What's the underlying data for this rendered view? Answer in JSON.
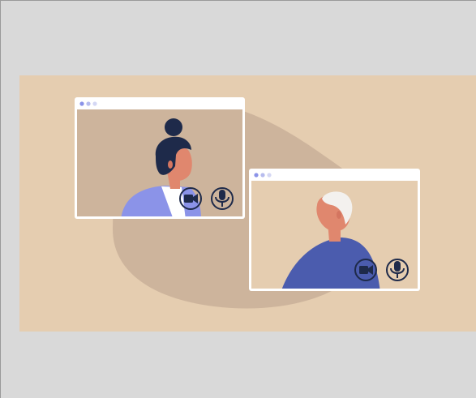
{
  "scene": {
    "description_kind": "video-call illustration",
    "colors": {
      "page_background": "#d9d9d9",
      "panel_background": "#e5cdb0",
      "blob": "#cdb49c",
      "window_frame": "#ffffff",
      "window_dots": "#8b93e8",
      "skin": "#e0876e",
      "hair_dark": "#1e2a4a",
      "hair_white": "#f3f1ee",
      "shirt_light": "#8b93e8",
      "shirt_dark": "#4b5cae",
      "icon_stroke": "#1e2a4a"
    },
    "windows": [
      {
        "name": "left-call-window",
        "controls": [
          "video-camera-icon",
          "microphone-icon"
        ]
      },
      {
        "name": "right-call-window",
        "controls": [
          "video-camera-icon",
          "microphone-icon"
        ]
      }
    ]
  }
}
